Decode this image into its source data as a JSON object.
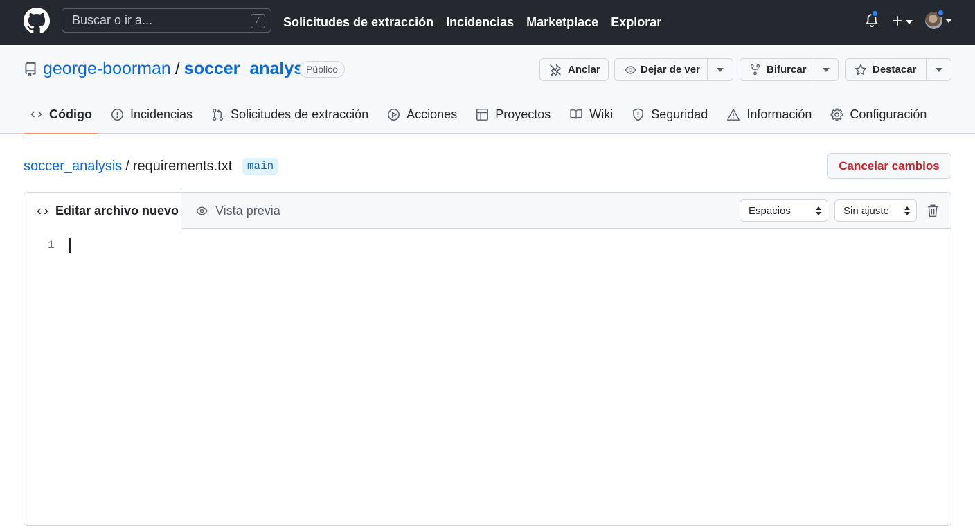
{
  "header": {
    "search_placeholder": "Buscar o ir a...",
    "search_key": "/",
    "nav": [
      "Solicitudes de extracción",
      "Incidencias",
      "Marketplace",
      "Explorar"
    ]
  },
  "repo": {
    "owner": "george-boorman",
    "separator": "/",
    "name": "soccer_analysis",
    "visibility": "Público",
    "actions": {
      "pin": "Anclar",
      "watch": "Dejar de ver",
      "fork": "Bifurcar",
      "star": "Destacar"
    },
    "tabs": [
      {
        "label": "Código",
        "icon": "code-icon"
      },
      {
        "label": "Incidencias",
        "icon": "issue-icon"
      },
      {
        "label": "Solicitudes de extracción",
        "icon": "pull-request-icon"
      },
      {
        "label": "Acciones",
        "icon": "play-icon"
      },
      {
        "label": "Proyectos",
        "icon": "table-icon"
      },
      {
        "label": "Wiki",
        "icon": "book-icon"
      },
      {
        "label": "Seguridad",
        "icon": "shield-icon"
      },
      {
        "label": "Información",
        "icon": "graph-icon"
      },
      {
        "label": "Configuración",
        "icon": "gear-icon"
      }
    ]
  },
  "file": {
    "repo_crumb": "soccer_analysis",
    "separator": "/",
    "filename": "requirements.txt",
    "branch": "main",
    "cancel_label": "Cancelar cambios"
  },
  "editor": {
    "edit_tab": "Editar archivo nuevo",
    "preview_tab": "Vista previa",
    "indent_mode": "Espacios",
    "wrap_mode": "Sin ajuste",
    "line_number": "1"
  },
  "colors": {
    "header_bg": "#24292f",
    "link": "#0969da",
    "danger": "#cf222e",
    "active_tab_underline": "#fd8c73",
    "notification_dot": "#2f81f7"
  }
}
